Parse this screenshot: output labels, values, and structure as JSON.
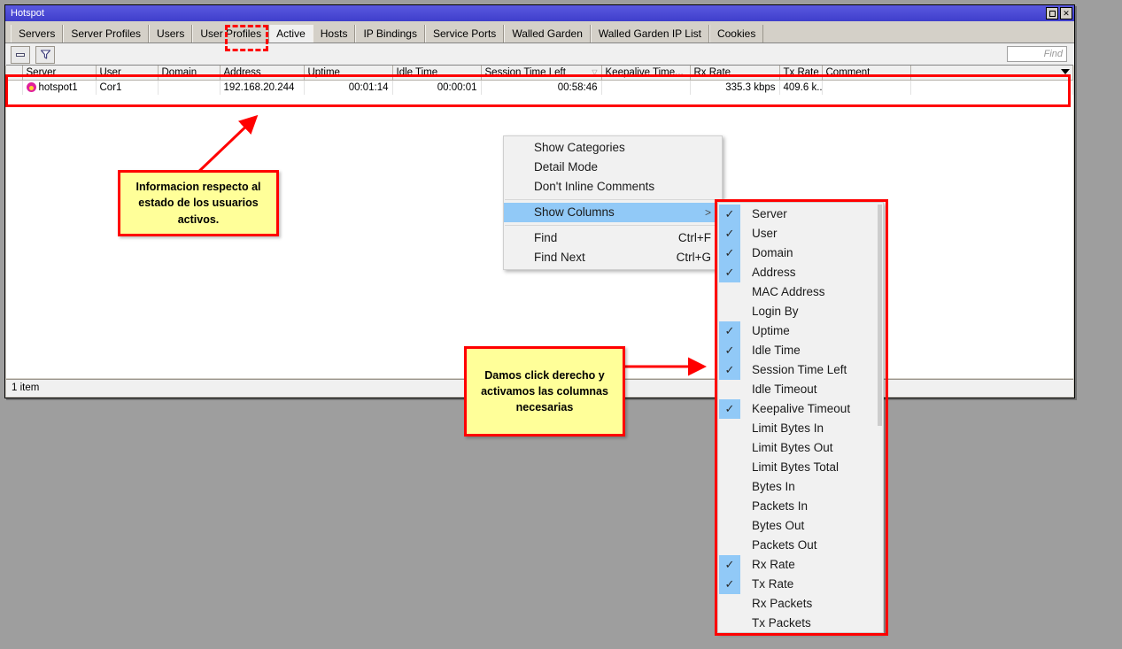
{
  "window": {
    "title": "Hotspot",
    "buttons": [
      {
        "name": "maximize",
        "glyph": "□"
      },
      {
        "name": "close",
        "glyph": "✕"
      }
    ]
  },
  "tabs": [
    {
      "label": "Servers",
      "active": false
    },
    {
      "label": "Server Profiles",
      "active": false
    },
    {
      "label": "Users",
      "active": false
    },
    {
      "label": "User Profiles",
      "active": false
    },
    {
      "label": "Active",
      "active": true
    },
    {
      "label": "Hosts",
      "active": false
    },
    {
      "label": "IP Bindings",
      "active": false
    },
    {
      "label": "Service Ports",
      "active": false
    },
    {
      "label": "Walled Garden",
      "active": false
    },
    {
      "label": "Walled Garden IP List",
      "active": false
    },
    {
      "label": "Cookies",
      "active": false
    }
  ],
  "toolbar": {
    "remove_button_label": "",
    "filter_button_label": "",
    "find_placeholder": "Find",
    "find_value": ""
  },
  "table": {
    "columns": [
      "Server",
      "User",
      "Domain",
      "Address",
      "Uptime",
      "Idle Time",
      "Session Time Left",
      "Keepalive Time...",
      "Rx Rate",
      "Tx Rate",
      "Comment"
    ],
    "sort_marks": {
      "Session Time Left": "▽",
      "Keepalive Time...": "△"
    },
    "rows": [
      {
        "Server": "hotspot1",
        "User": "Cor1",
        "Domain": "",
        "Address": "192.168.20.244",
        "Uptime": "00:01:14",
        "Idle Time": "00:00:01",
        "Session Time Left": "00:58:46",
        "Keepalive Time...": "",
        "Rx Rate": "335.3 kbps",
        "Tx Rate": "409.6 k...",
        "Comment": ""
      }
    ]
  },
  "statusbar": {
    "text": "1 item"
  },
  "context_menu": {
    "items": [
      {
        "label": "Show Categories",
        "accel": "",
        "highlighted": false,
        "submenu": false
      },
      {
        "label": "Detail Mode",
        "accel": "",
        "highlighted": false,
        "submenu": false
      },
      {
        "label": "Don't Inline Comments",
        "accel": "",
        "highlighted": false,
        "submenu": false
      },
      {
        "separator": true
      },
      {
        "label": "Show Columns",
        "accel": "",
        "highlighted": true,
        "submenu": true
      },
      {
        "separator": true
      },
      {
        "label": "Find",
        "accel": "Ctrl+F",
        "highlighted": false,
        "submenu": false
      },
      {
        "label": "Find Next",
        "accel": "Ctrl+G",
        "highlighted": false,
        "submenu": false
      }
    ]
  },
  "columns_submenu": {
    "items": [
      {
        "label": "Server",
        "checked": true
      },
      {
        "label": "User",
        "checked": true
      },
      {
        "label": "Domain",
        "checked": true
      },
      {
        "label": "Address",
        "checked": true
      },
      {
        "label": "MAC Address",
        "checked": false
      },
      {
        "label": "Login By",
        "checked": false
      },
      {
        "label": "Uptime",
        "checked": true
      },
      {
        "label": "Idle Time",
        "checked": true
      },
      {
        "label": "Session Time Left",
        "checked": true
      },
      {
        "label": "Idle Timeout",
        "checked": false
      },
      {
        "label": "Keepalive Timeout",
        "checked": true
      },
      {
        "label": "Limit Bytes In",
        "checked": false
      },
      {
        "label": "Limit Bytes Out",
        "checked": false
      },
      {
        "label": "Limit Bytes Total",
        "checked": false
      },
      {
        "label": "Bytes In",
        "checked": false
      },
      {
        "label": "Packets In",
        "checked": false
      },
      {
        "label": "Bytes Out",
        "checked": false
      },
      {
        "label": "Packets Out",
        "checked": false
      },
      {
        "label": "Rx Rate",
        "checked": true
      },
      {
        "label": "Tx Rate",
        "checked": true
      },
      {
        "label": "Rx Packets",
        "checked": false
      },
      {
        "label": "Tx Packets",
        "checked": false
      }
    ],
    "check_glyph": "✓"
  },
  "annotations": {
    "callout_1": "Informacion respecto al estado de los usuarios activos.",
    "callout_2": "Damos click derecho y activamos las columnas necesarias"
  },
  "colors": {
    "accent_red": "#ff0000",
    "callout_yellow": "#ffff99",
    "titlebar_blue": "#4a49d9",
    "menu_highlight": "#91c9f7",
    "desktop": "#9e9e9e"
  }
}
